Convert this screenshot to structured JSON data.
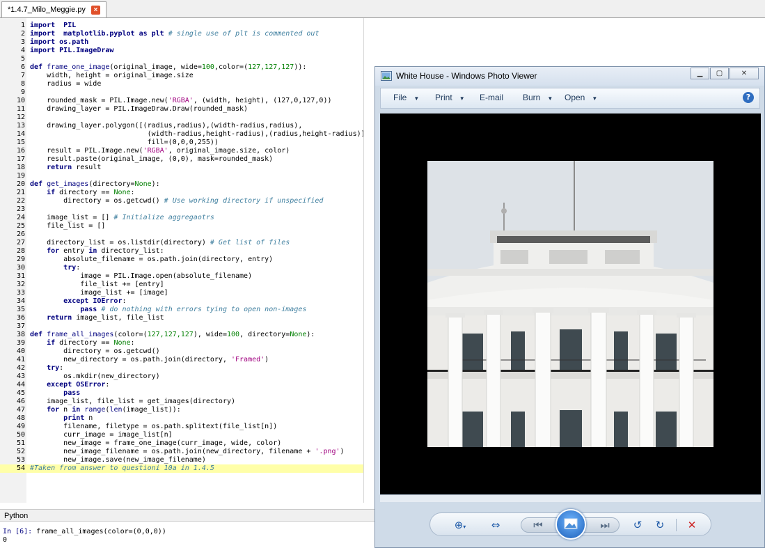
{
  "editor": {
    "tab_title": "*1.4.7_Milo_Meggie.py",
    "tab_close_glyph": "×",
    "current_line": "54",
    "lines": [
      {
        "n": "1",
        "segs": [
          [
            "kw",
            "import"
          ],
          [
            "",
            "  "
          ],
          [
            "kw",
            "PIL"
          ]
        ]
      },
      {
        "n": "2",
        "segs": [
          [
            "kw",
            "import"
          ],
          [
            "",
            "  "
          ],
          [
            "kw",
            "matplotlib.pyplot"
          ],
          [
            "",
            " "
          ],
          [
            "kw",
            "as"
          ],
          [
            "",
            " "
          ],
          [
            "kw",
            "plt"
          ],
          [
            "",
            " "
          ],
          [
            "cm",
            "# single use of plt is commented out"
          ]
        ]
      },
      {
        "n": "3",
        "segs": [
          [
            "kw",
            "import"
          ],
          [
            "",
            " "
          ],
          [
            "kw",
            "os.path"
          ]
        ]
      },
      {
        "n": "4",
        "segs": [
          [
            "kw",
            "import"
          ],
          [
            "",
            " "
          ],
          [
            "kw",
            "PIL.ImageDraw"
          ]
        ]
      },
      {
        "n": "5",
        "segs": []
      },
      {
        "n": "6",
        "segs": [
          [
            "kw",
            "def"
          ],
          [
            "",
            " "
          ],
          [
            "fn",
            "frame_one_image"
          ],
          [
            "",
            "(original_image, wide="
          ],
          [
            "nm",
            "100"
          ],
          [
            "",
            ",color=("
          ],
          [
            "nm",
            "127,127,127"
          ],
          [
            "",
            "))"
          ],
          [
            "",
            ":"
          ]
        ]
      },
      {
        "n": "7",
        "segs": [
          [
            "",
            "    width, height = original_image.size"
          ]
        ]
      },
      {
        "n": "8",
        "segs": [
          [
            "",
            "    radius = wide"
          ]
        ]
      },
      {
        "n": "9",
        "segs": []
      },
      {
        "n": "10",
        "segs": [
          [
            "",
            "    rounded_mask = PIL.Image.new("
          ],
          [
            "st",
            "'RGBA'"
          ],
          [
            "",
            ", (width, height), (127,0,127,0))"
          ]
        ]
      },
      {
        "n": "11",
        "segs": [
          [
            "",
            "    drawing_layer = PIL.ImageDraw.Draw(rounded_mask)"
          ]
        ]
      },
      {
        "n": "12",
        "segs": []
      },
      {
        "n": "13",
        "segs": [
          [
            "",
            "    drawing_layer.polygon([(radius,radius),(width-radius,radius),"
          ]
        ]
      },
      {
        "n": "14",
        "segs": [
          [
            "",
            "                            (width-radius,height-radius),(radius,height-radius)],"
          ]
        ]
      },
      {
        "n": "15",
        "segs": [
          [
            "",
            "                            fill=(0,0,0,255))"
          ]
        ]
      },
      {
        "n": "16",
        "segs": [
          [
            "",
            "    result = PIL.Image.new("
          ],
          [
            "st",
            "'RGBA'"
          ],
          [
            "",
            ", original_image.size, color)"
          ]
        ]
      },
      {
        "n": "17",
        "segs": [
          [
            "",
            "    result.paste(original_image, (0,0), mask=rounded_mask)"
          ]
        ]
      },
      {
        "n": "18",
        "segs": [
          [
            "",
            "    "
          ],
          [
            "kw",
            "return"
          ],
          [
            "",
            " result"
          ]
        ]
      },
      {
        "n": "19",
        "segs": []
      },
      {
        "n": "20",
        "segs": [
          [
            "kw",
            "def"
          ],
          [
            "",
            " "
          ],
          [
            "fn",
            "get_images"
          ],
          [
            "",
            "(directory="
          ],
          [
            "nm",
            "None"
          ],
          [
            "",
            "):"
          ]
        ]
      },
      {
        "n": "21",
        "segs": [
          [
            "",
            "    "
          ],
          [
            "kw",
            "if"
          ],
          [
            "",
            " directory == "
          ],
          [
            "nm",
            "None"
          ],
          [
            "",
            ":"
          ]
        ]
      },
      {
        "n": "22",
        "segs": [
          [
            "",
            "        directory = os.getcwd() "
          ],
          [
            "cm",
            "# Use working directory if unspecified"
          ]
        ]
      },
      {
        "n": "23",
        "segs": []
      },
      {
        "n": "24",
        "segs": [
          [
            "",
            "    image_list = [] "
          ],
          [
            "cm",
            "# Initialize aggregaotrs"
          ]
        ]
      },
      {
        "n": "25",
        "segs": [
          [
            "",
            "    file_list = []"
          ]
        ]
      },
      {
        "n": "26",
        "segs": []
      },
      {
        "n": "27",
        "segs": [
          [
            "",
            "    directory_list = os.listdir(directory) "
          ],
          [
            "cm",
            "# Get list of files"
          ]
        ]
      },
      {
        "n": "28",
        "segs": [
          [
            "",
            "    "
          ],
          [
            "kw",
            "for"
          ],
          [
            "",
            " entry "
          ],
          [
            "kw",
            "in"
          ],
          [
            "",
            " directory_list:"
          ]
        ]
      },
      {
        "n": "29",
        "segs": [
          [
            "",
            "        absolute_filename = os.path.join(directory, entry)"
          ]
        ]
      },
      {
        "n": "30",
        "segs": [
          [
            "",
            "        "
          ],
          [
            "kw",
            "try"
          ],
          [
            "",
            ":"
          ]
        ]
      },
      {
        "n": "31",
        "segs": [
          [
            "",
            "            image = PIL.Image.open(absolute_filename)"
          ]
        ]
      },
      {
        "n": "32",
        "segs": [
          [
            "",
            "            file_list += [entry]"
          ]
        ]
      },
      {
        "n": "33",
        "segs": [
          [
            "",
            "            image_list += [image]"
          ]
        ]
      },
      {
        "n": "34",
        "segs": [
          [
            "",
            "        "
          ],
          [
            "kw",
            "except"
          ],
          [
            "",
            " "
          ],
          [
            "kw",
            "IOError"
          ],
          [
            "",
            ":"
          ]
        ]
      },
      {
        "n": "35",
        "segs": [
          [
            "",
            "            "
          ],
          [
            "kw",
            "pass"
          ],
          [
            "",
            " "
          ],
          [
            "cm",
            "# do nothing with errors tying to open non-images"
          ]
        ]
      },
      {
        "n": "36",
        "segs": [
          [
            "",
            "    "
          ],
          [
            "kw",
            "return"
          ],
          [
            "",
            " image_list, file_list"
          ]
        ]
      },
      {
        "n": "37",
        "segs": []
      },
      {
        "n": "38",
        "segs": [
          [
            "kw",
            "def"
          ],
          [
            "",
            " "
          ],
          [
            "fn",
            "frame_all_images"
          ],
          [
            "",
            "(color=("
          ],
          [
            "nm",
            "127,127,127"
          ],
          [
            "",
            "), wide="
          ],
          [
            "nm",
            "100"
          ],
          [
            "",
            ", directory="
          ],
          [
            "nm",
            "None"
          ],
          [
            "",
            "):"
          ]
        ]
      },
      {
        "n": "39",
        "segs": [
          [
            "",
            "    "
          ],
          [
            "kw",
            "if"
          ],
          [
            "",
            " directory == "
          ],
          [
            "nm",
            "None"
          ],
          [
            "",
            ":"
          ]
        ]
      },
      {
        "n": "40",
        "segs": [
          [
            "",
            "        directory = os.getcwd()"
          ]
        ]
      },
      {
        "n": "41",
        "segs": [
          [
            "",
            "        new_directory = os.path.join(directory, "
          ],
          [
            "st",
            "'Framed'"
          ],
          [
            "",
            ")"
          ]
        ]
      },
      {
        "n": "42",
        "segs": [
          [
            "",
            "    "
          ],
          [
            "kw",
            "try"
          ],
          [
            "",
            ":"
          ]
        ]
      },
      {
        "n": "43",
        "segs": [
          [
            "",
            "        os.mkdir(new_directory)"
          ]
        ]
      },
      {
        "n": "44",
        "segs": [
          [
            "",
            "    "
          ],
          [
            "kw",
            "except"
          ],
          [
            "",
            " "
          ],
          [
            "kw",
            "OSError"
          ],
          [
            "",
            ":"
          ]
        ]
      },
      {
        "n": "45",
        "segs": [
          [
            "",
            "        "
          ],
          [
            "kw",
            "pass"
          ]
        ]
      },
      {
        "n": "46",
        "segs": [
          [
            "",
            "    image_list, file_list = get_images(directory)"
          ]
        ]
      },
      {
        "n": "47",
        "segs": [
          [
            "",
            "    "
          ],
          [
            "kw",
            "for"
          ],
          [
            "",
            " n "
          ],
          [
            "kw",
            "in"
          ],
          [
            "",
            " "
          ],
          [
            "fn",
            "range"
          ],
          [
            "",
            "("
          ],
          [
            "fn",
            "len"
          ],
          [
            "",
            "(image_list)):"
          ]
        ]
      },
      {
        "n": "48",
        "segs": [
          [
            "",
            "        "
          ],
          [
            "kw",
            "print"
          ],
          [
            "",
            " n"
          ]
        ]
      },
      {
        "n": "49",
        "segs": [
          [
            "",
            "        filename, filetype = os.path.splitext(file_list[n])"
          ]
        ]
      },
      {
        "n": "50",
        "segs": [
          [
            "",
            "        curr_image = image_list[n]"
          ]
        ]
      },
      {
        "n": "51",
        "segs": [
          [
            "",
            "        new_image = frame_one_image(curr_image, wide, color)"
          ]
        ]
      },
      {
        "n": "52",
        "segs": [
          [
            "",
            "        new_image_filename = os.path.join(new_directory, filename + "
          ],
          [
            "st",
            "'.png'"
          ],
          [
            "",
            ")"
          ]
        ]
      },
      {
        "n": "53",
        "segs": [
          [
            "",
            "        new_image.save(new_image_filename)"
          ]
        ]
      },
      {
        "n": "54",
        "segs": [
          [
            "cm",
            "#Taken from answer to questioni 10a in 1.4.5"
          ]
        ]
      }
    ]
  },
  "shell": {
    "header": "Python",
    "prompt": "In [6]:",
    "command": " frame_all_images(color=(0,0,0))",
    "output": "0"
  },
  "viewer": {
    "title": "White House - Windows Photo Viewer",
    "menu": [
      "File",
      "Print",
      "E-mail",
      "Burn",
      "Open"
    ],
    "help_glyph": "?",
    "photo_subject": "white-house-photo",
    "colors": {
      "sky": "#dde2e7",
      "building": "#f2f2f0",
      "frame": "#000000"
    }
  }
}
